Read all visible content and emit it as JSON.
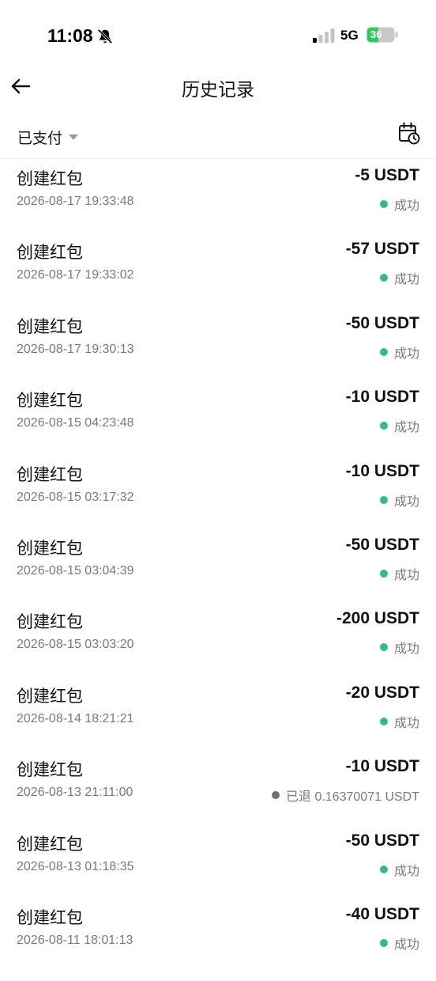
{
  "status_bar": {
    "time": "11:08",
    "network": "5G",
    "battery": "36"
  },
  "nav": {
    "title": "历史记录"
  },
  "filter": {
    "label": "已支付"
  },
  "colors": {
    "success": "#2ebd85",
    "refund": "#6d6d6d",
    "battery_fill": "#34c759"
  },
  "records": [
    {
      "title": "创建红包",
      "amount": "-5 USDT",
      "date": "2026-08-17 19:33:48",
      "status": "成功",
      "status_type": "success"
    },
    {
      "title": "创建红包",
      "amount": "-57 USDT",
      "date": "2026-08-17 19:33:02",
      "status": "成功",
      "status_type": "success"
    },
    {
      "title": "创建红包",
      "amount": "-50 USDT",
      "date": "2026-08-17 19:30:13",
      "status": "成功",
      "status_type": "success"
    },
    {
      "title": "创建红包",
      "amount": "-10 USDT",
      "date": "2026-08-15 04:23:48",
      "status": "成功",
      "status_type": "success"
    },
    {
      "title": "创建红包",
      "amount": "-10 USDT",
      "date": "2026-08-15 03:17:32",
      "status": "成功",
      "status_type": "success"
    },
    {
      "title": "创建红包",
      "amount": "-50 USDT",
      "date": "2026-08-15 03:04:39",
      "status": "成功",
      "status_type": "success"
    },
    {
      "title": "创建红包",
      "amount": "-200 USDT",
      "date": "2026-08-15 03:03:20",
      "status": "成功",
      "status_type": "success"
    },
    {
      "title": "创建红包",
      "amount": "-20 USDT",
      "date": "2026-08-14 18:21:21",
      "status": "成功",
      "status_type": "success"
    },
    {
      "title": "创建红包",
      "amount": "-10 USDT",
      "date": "2026-08-13 21:11:00",
      "status": "已退 0.16370071 USDT",
      "status_type": "refund"
    },
    {
      "title": "创建红包",
      "amount": "-50 USDT",
      "date": "2026-08-13 01:18:35",
      "status": "成功",
      "status_type": "success"
    },
    {
      "title": "创建红包",
      "amount": "-40 USDT",
      "date": "2026-08-11 18:01:13",
      "status": "成功",
      "status_type": "success"
    }
  ]
}
